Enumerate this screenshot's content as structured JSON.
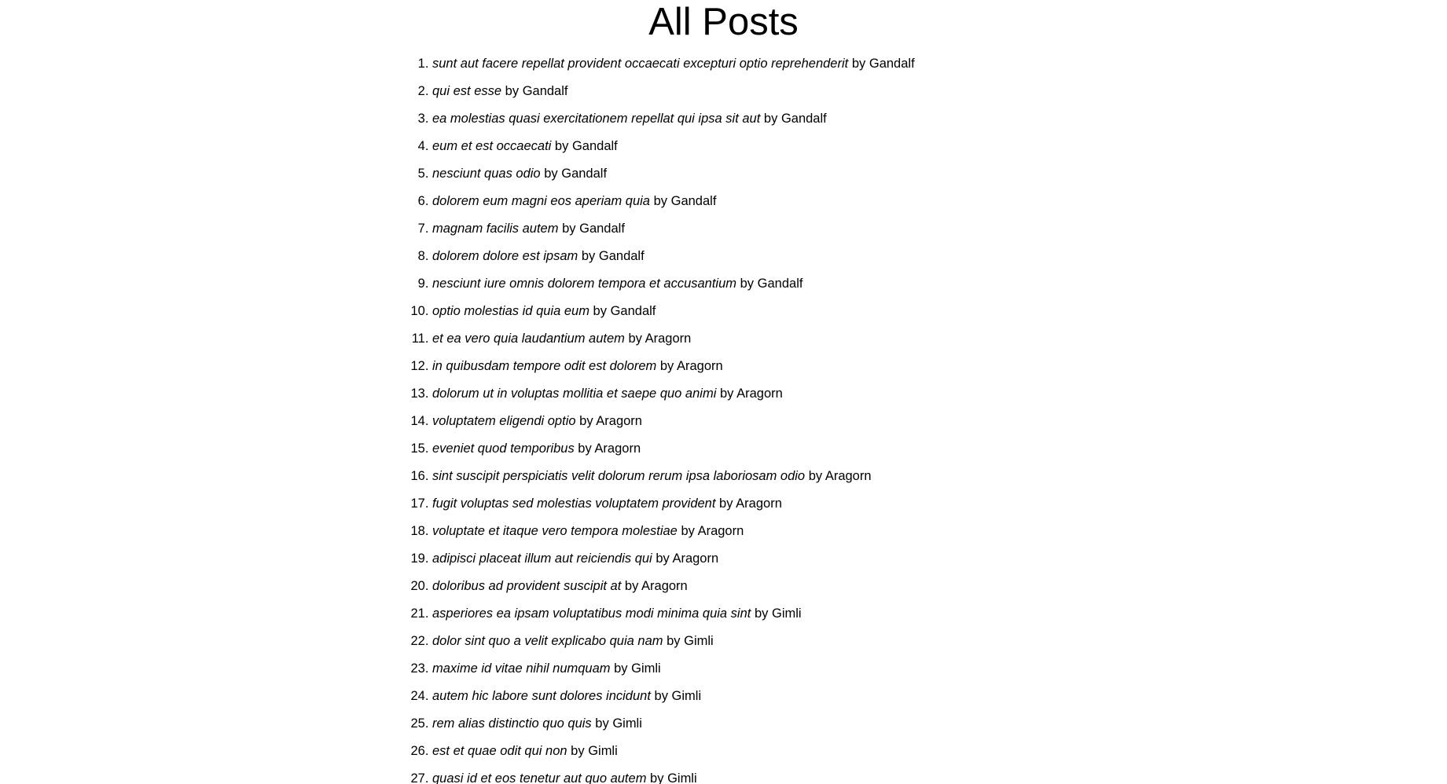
{
  "page": {
    "title": "All Posts"
  },
  "posts": [
    {
      "title": "sunt aut facere repellat provident occaecati excepturi optio reprehenderit",
      "author": "Gandalf"
    },
    {
      "title": "qui est esse",
      "author": "Gandalf"
    },
    {
      "title": "ea molestias quasi exercitationem repellat qui ipsa sit aut",
      "author": "Gandalf"
    },
    {
      "title": "eum et est occaecati",
      "author": "Gandalf"
    },
    {
      "title": "nesciunt quas odio",
      "author": "Gandalf"
    },
    {
      "title": "dolorem eum magni eos aperiam quia",
      "author": "Gandalf"
    },
    {
      "title": "magnam facilis autem",
      "author": "Gandalf"
    },
    {
      "title": "dolorem dolore est ipsam",
      "author": "Gandalf"
    },
    {
      "title": "nesciunt iure omnis dolorem tempora et accusantium",
      "author": "Gandalf"
    },
    {
      "title": "optio molestias id quia eum",
      "author": "Gandalf"
    },
    {
      "title": "et ea vero quia laudantium autem",
      "author": "Aragorn"
    },
    {
      "title": "in quibusdam tempore odit est dolorem",
      "author": "Aragorn"
    },
    {
      "title": "dolorum ut in voluptas mollitia et saepe quo animi",
      "author": "Aragorn"
    },
    {
      "title": "voluptatem eligendi optio",
      "author": "Aragorn"
    },
    {
      "title": "eveniet quod temporibus",
      "author": "Aragorn"
    },
    {
      "title": "sint suscipit perspiciatis velit dolorum rerum ipsa laboriosam odio",
      "author": "Aragorn"
    },
    {
      "title": "fugit voluptas sed molestias voluptatem provident",
      "author": "Aragorn"
    },
    {
      "title": "voluptate et itaque vero tempora molestiae",
      "author": "Aragorn"
    },
    {
      "title": "adipisci placeat illum aut reiciendis qui",
      "author": "Aragorn"
    },
    {
      "title": "doloribus ad provident suscipit at",
      "author": "Aragorn"
    },
    {
      "title": "asperiores ea ipsam voluptatibus modi minima quia sint",
      "author": "Gimli"
    },
    {
      "title": "dolor sint quo a velit explicabo quia nam",
      "author": "Gimli"
    },
    {
      "title": "maxime id vitae nihil numquam",
      "author": "Gimli"
    },
    {
      "title": "autem hic labore sunt dolores incidunt",
      "author": "Gimli"
    },
    {
      "title": "rem alias distinctio quo quis",
      "author": "Gimli"
    },
    {
      "title": "est et quae odit qui non",
      "author": "Gimli"
    },
    {
      "title": "quasi id et eos tenetur aut quo autem",
      "author": "Gimli"
    }
  ],
  "labels": {
    "by": "by"
  }
}
